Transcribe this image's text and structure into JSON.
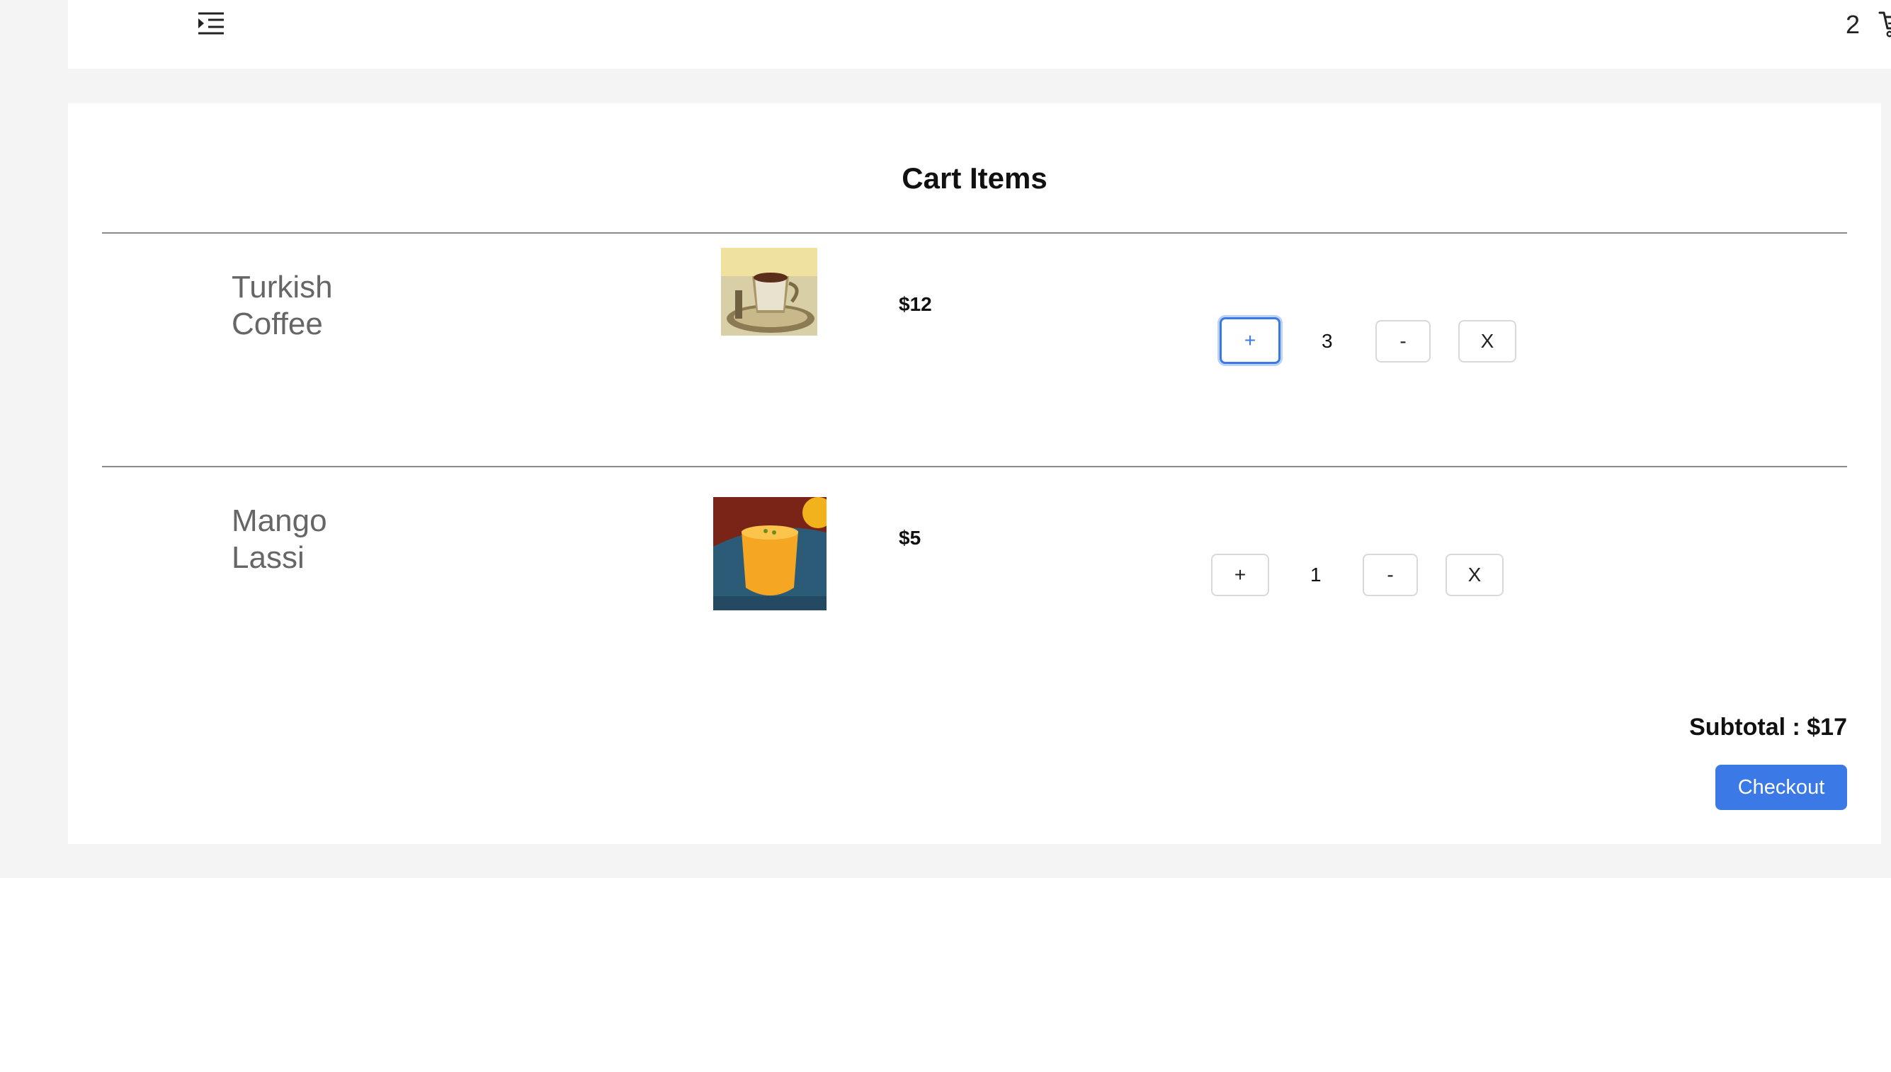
{
  "header": {
    "menu_icon": "list-indent-icon",
    "cart_count": "2",
    "cart_icon": "shopping-cart-icon"
  },
  "cart": {
    "title": "Cart Items",
    "items": [
      {
        "name": "Turkish Coffee",
        "price": "$12",
        "quantity": "3",
        "plus_label": "+",
        "minus_label": "-",
        "remove_label": "X"
      },
      {
        "name": "Mango Lassi",
        "price": "$5",
        "quantity": "1",
        "plus_label": "+",
        "minus_label": "-",
        "remove_label": "X"
      }
    ],
    "subtotal": "Subtotal : $17",
    "checkout_label": "Checkout"
  },
  "colors": {
    "accent": "#3b7ae6",
    "page_bg": "#f4f4f4",
    "text_muted": "#666666"
  }
}
